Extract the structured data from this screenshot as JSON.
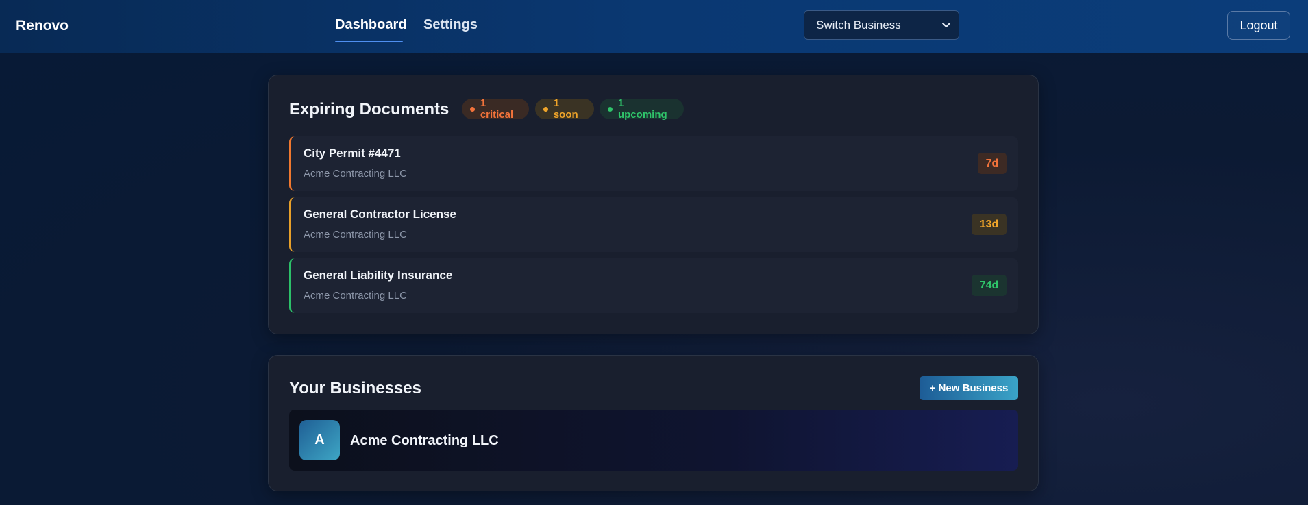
{
  "header": {
    "brand": "Renovo",
    "tabs": [
      {
        "label": "Dashboard",
        "active": true
      },
      {
        "label": "Settings",
        "active": false
      }
    ],
    "switch_business": {
      "selected": "Switch Business"
    },
    "logout_label": "Logout"
  },
  "expiring": {
    "title": "Expiring Documents",
    "badges": [
      {
        "label": "1 critical",
        "color": "#f2733b"
      },
      {
        "label": "1 soon",
        "color": "#f0a52a"
      },
      {
        "label": "1 upcoming",
        "color": "#2fc46a"
      }
    ],
    "documents": [
      {
        "name": "City Permit #4471",
        "business": "Acme Contracting LLC",
        "days": "7d",
        "status": "critical",
        "color": "#f0782f"
      },
      {
        "name": "General Contractor License",
        "business": "Acme Contracting LLC",
        "days": "13d",
        "status": "soon",
        "color": "#e8a02a"
      },
      {
        "name": "General Liability Insurance",
        "business": "Acme Contracting LLC",
        "days": "74d",
        "status": "upcoming",
        "color": "#2cc069"
      }
    ]
  },
  "businesses": {
    "title": "Your Businesses",
    "new_button": "+ New Business",
    "items": [
      {
        "initial": "A",
        "name": "Acme Contracting LLC"
      }
    ]
  },
  "icons": {
    "select_arrow": "chevron-down-icon"
  },
  "colors": {
    "accent": "#4f8ff0",
    "card_bg": "#191f2e",
    "topbar": "#0a3872"
  }
}
